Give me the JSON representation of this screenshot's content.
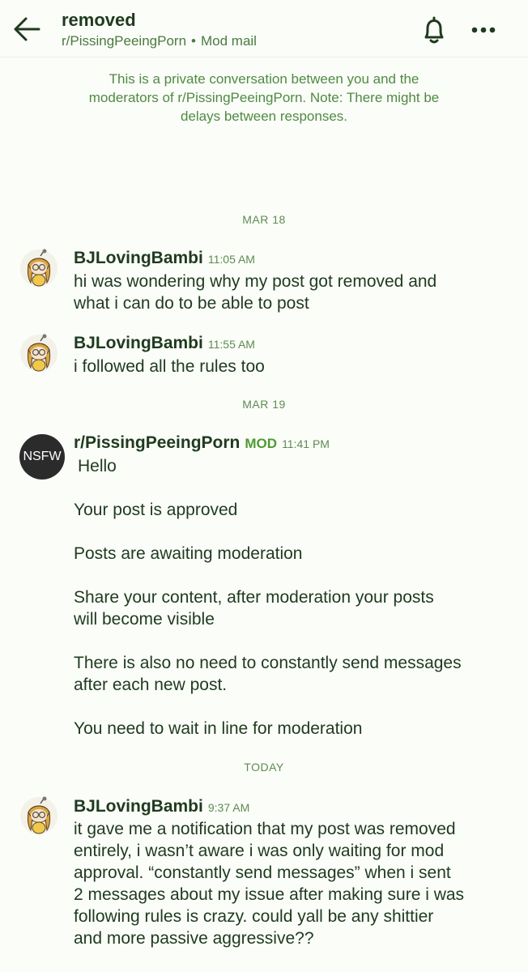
{
  "header": {
    "title": "removed",
    "subreddit": "r/PissingPeeingPorn",
    "separator": "•",
    "section": "Mod mail"
  },
  "notice": {
    "lines": [
      "This is a private conversation between you and the",
      "moderators of r/PissingPeeingPorn. Note: There might be",
      "delays between responses."
    ]
  },
  "dates": {
    "mar18": "MAR 18",
    "mar19": "MAR 19",
    "today": "TODAY"
  },
  "messages": [
    {
      "author": "BJLovingBambi",
      "time": "11:05 AM",
      "lines": [
        "hi was wondering why my post got removed and",
        "what i can do to be able to post"
      ]
    },
    {
      "author": "BJLovingBambi",
      "time": "11:55 AM",
      "lines": [
        "i followed all the rules too"
      ]
    },
    {
      "author": "r/PissingPeeingPorn",
      "badge": "MOD",
      "time": "11:41 PM",
      "avatar_text": "NSFW",
      "paragraphs": [
        [
          "Hello"
        ],
        [
          "Your post is approved"
        ],
        [
          "Posts are awaiting moderation"
        ],
        [
          "Share your content, after moderation your posts",
          "will become visible"
        ],
        [
          "There is also no need to constantly send messages",
          "after each new post."
        ],
        [
          "You need to wait in line for moderation"
        ]
      ]
    },
    {
      "author": "BJLovingBambi",
      "time": "9:37 AM",
      "lines": [
        "it gave me a notification that my post was removed",
        "entirely, i wasn’t aware i was only waiting for mod",
        "approval. “constantly send messages” when i sent",
        "2 messages about my issue after making sure i was",
        "following rules is crazy. could yall be any shittier",
        "and more passive aggressive??"
      ]
    }
  ],
  "icons": {
    "back": "arrow-left-icon",
    "bell": "bell-icon",
    "more": "more-horizontal-icon",
    "avatar": "snoo-avatar-icon"
  },
  "colors": {
    "background": "#fbfdf8",
    "text": "#1f3a1f",
    "accent": "#4f8a43",
    "mod_badge": "#4f9a35",
    "nsfw_avatar": "#2b2b2b"
  }
}
